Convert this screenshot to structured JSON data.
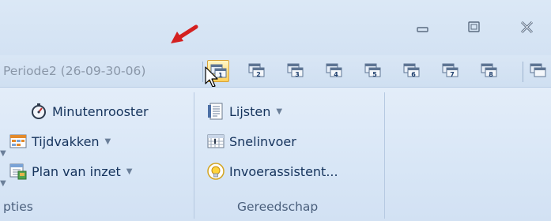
{
  "toolbar": {
    "periode_label": "Periode2 (26-09-30-06)",
    "period_buttons": [
      {
        "num": "1",
        "active": true
      },
      {
        "num": "2",
        "active": false
      },
      {
        "num": "3",
        "active": false
      },
      {
        "num": "4",
        "active": false
      },
      {
        "num": "5",
        "active": false
      },
      {
        "num": "6",
        "active": false
      },
      {
        "num": "7",
        "active": false
      },
      {
        "num": "8",
        "active": false
      }
    ]
  },
  "ribbon": {
    "opties_group": {
      "label": "pties",
      "items": [
        {
          "label": "Minutenrooster",
          "icon": "stopwatch-icon"
        },
        {
          "label": "Tijdvakken",
          "icon": "timeslots-icon"
        },
        {
          "label": "Plan van inzet",
          "icon": "plan-icon"
        }
      ]
    },
    "gereedschap_group": {
      "label": "Gereedschap",
      "items": [
        {
          "label": "Lijsten",
          "icon": "list-document-icon"
        },
        {
          "label": "Snelinvoer",
          "icon": "quick-entry-icon"
        },
        {
          "label": "Invoerassistent...",
          "icon": "lightbulb-icon"
        }
      ]
    }
  },
  "colors": {
    "accent_active": "#ffd05a",
    "text": "#15335c",
    "muted_text": "#8a97a8",
    "annotation_arrow": "#d42020"
  }
}
